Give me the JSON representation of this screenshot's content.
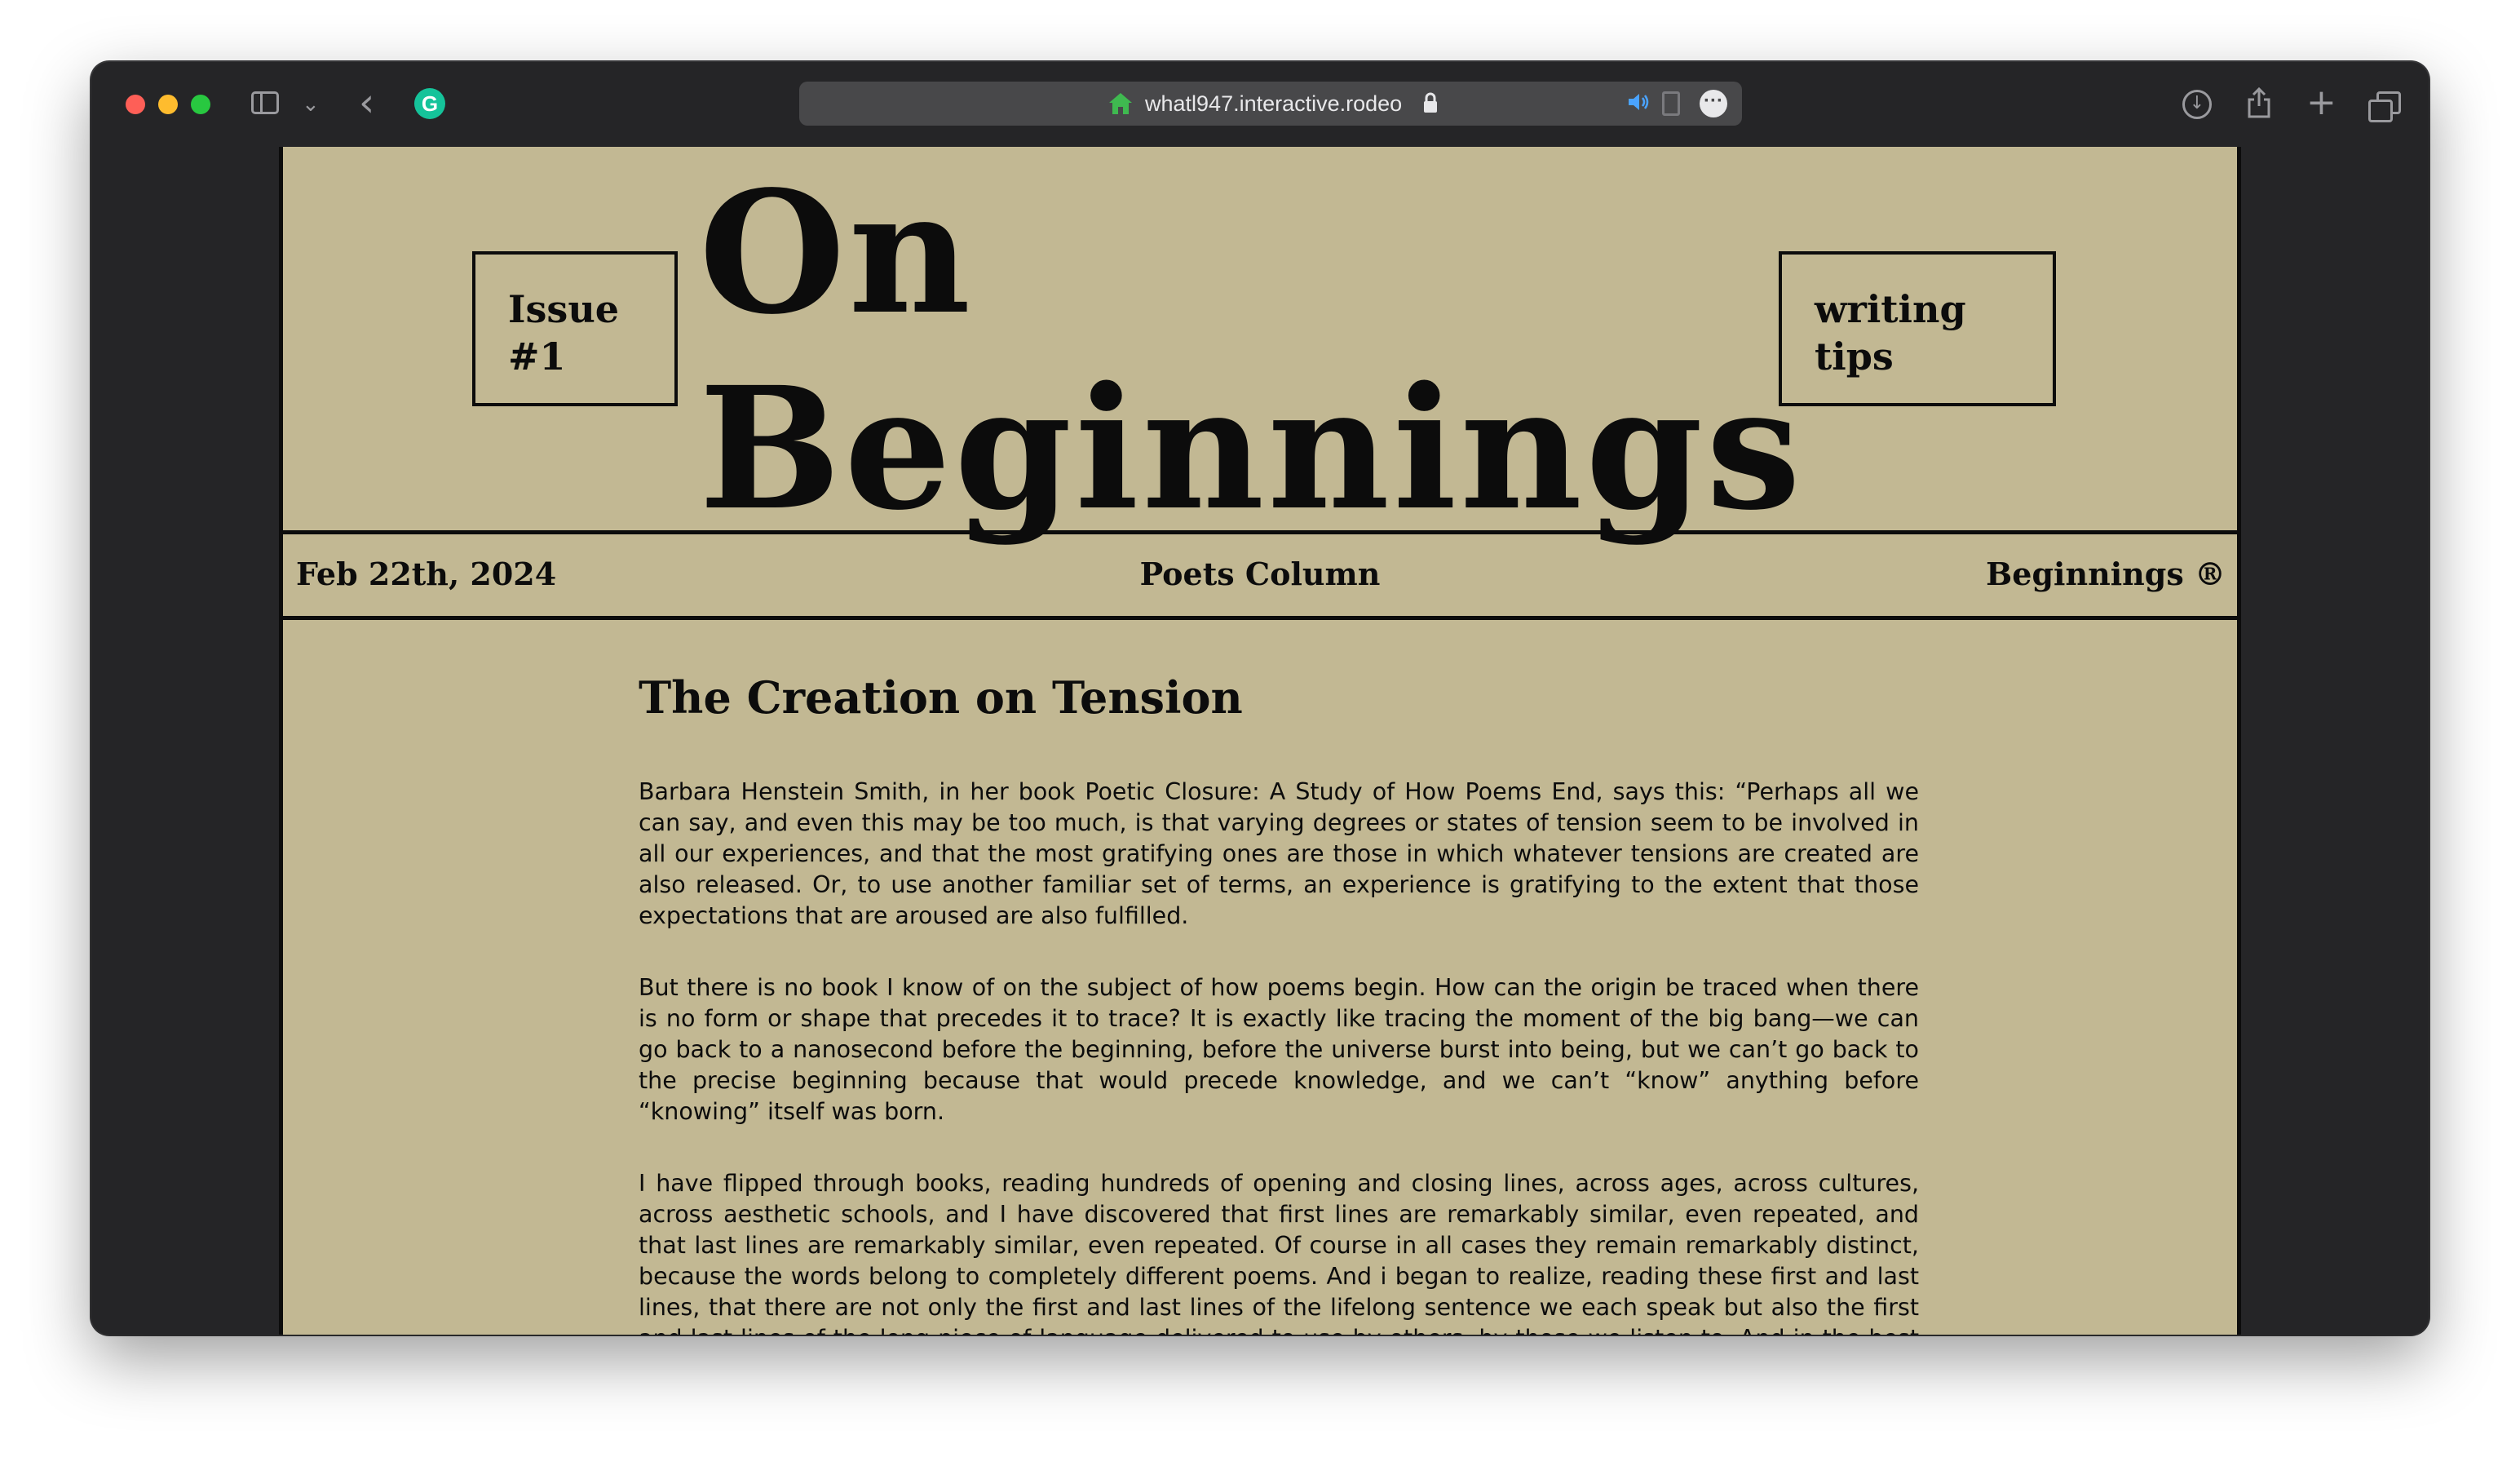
{
  "browser": {
    "url": "whatl947.interactive.rodeo"
  },
  "masthead": {
    "issue": "Issue #1",
    "title_line1": "On",
    "title_line2": "Beginnings",
    "tips": "writing tips"
  },
  "infobar": {
    "date": "Feb 22th, 2024",
    "column": "Poets Column",
    "brand": "Beginnings ®"
  },
  "article": {
    "heading": "The Creation on Tension",
    "paragraphs": [
      "Barbara Henstein Smith, in her book Poetic Closure: A Study of How Poems End, says this: “Perhaps all we can say, and even this may be too much, is that varying degrees or states of tension seem to be involved in all our experiences, and that the most gratifying ones are those in which whatever tensions are created are also released. Or, to use another familiar set of terms, an experience is gratifying to the extent that those expectations that are aroused are also fulfilled.",
      "But there is no book I know of on the subject of how poems begin. How can the origin be traced when there is no form or shape that precedes it to trace? It is exactly like tracing the moment of the big bang—we can go back to a nanosecond before the beginning, before the universe burst into being, but we can’t go back to the precise beginning because that would precede knowledge, and we can’t “know” anything before “knowing” itself was born.",
      "I have flipped through books, reading hundreds of opening and closing lines, across ages, across cultures, across aesthetic schools, and I have discovered that first lines are remarkably similar, even repeated, and that last lines are remarkably similar, even repeated. Of course in all cases they remain remarkably distinct, because the words belong to completely different poems. And i began to realize, reading these first and last lines, that there are not only the first and last lines of the lifelong sentence we each speak but also the first and last lines of the long piece of language delivered to use by others, by those we listen to. And in the best of all possible lives, that beginning and that end are the same: in poem after poem I encountered words that mark the first something made out of language"
    ]
  }
}
